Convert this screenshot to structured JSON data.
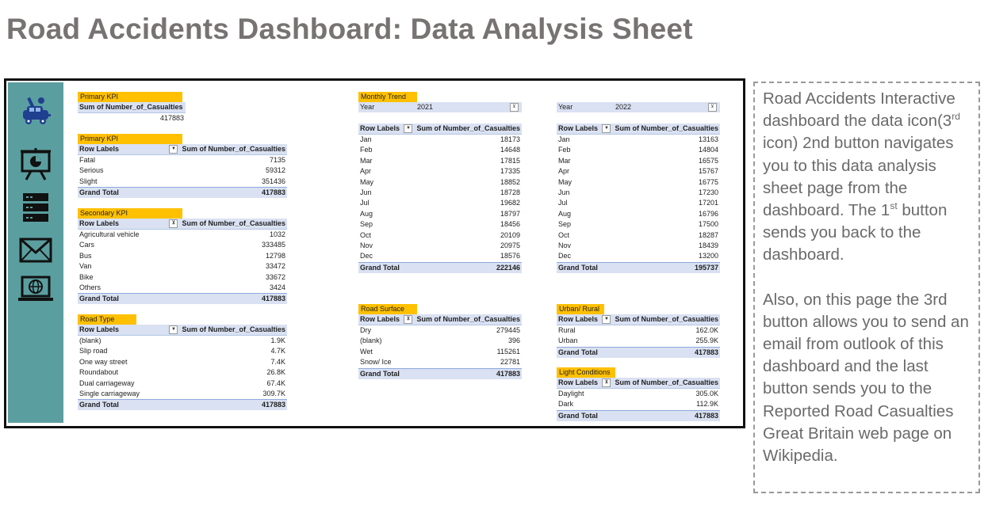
{
  "title": "Road Accidents Dashboard: Data Analysis Sheet",
  "sidebar": {
    "icons": [
      "car-crash-icon",
      "presentation-chart-icon",
      "database-server-icon",
      "mail-envelope-icon",
      "laptop-globe-icon"
    ]
  },
  "kpi_total": {
    "head": "Primary KPI",
    "label": "Sum of Number_of_Casualties",
    "value": "417883"
  },
  "severity": {
    "head": "Primary KPI",
    "col1": "Row Labels",
    "col2": "Sum of Number_of_Casualties",
    "rows": [
      {
        "label": "Fatal",
        "value": "7135"
      },
      {
        "label": "Serious",
        "value": "59312"
      },
      {
        "label": "Slight",
        "value": "351436"
      }
    ],
    "total_label": "Grand Total",
    "total_value": "417883"
  },
  "vehicle": {
    "head": "Secondary KPI",
    "col1": "Row Labels",
    "col2": "Sum of Number_of_Casualties",
    "rows": [
      {
        "label": "Agricultural vehicle",
        "value": "1032"
      },
      {
        "label": "Cars",
        "value": "333485"
      },
      {
        "label": "Bus",
        "value": "12798"
      },
      {
        "label": "Van",
        "value": "33472"
      },
      {
        "label": "Bike",
        "value": "33672"
      },
      {
        "label": "Others",
        "value": "3424"
      }
    ],
    "total_label": "Grand Total",
    "total_value": "417883"
  },
  "road_type": {
    "head": "Road Type",
    "col1": "Row Labels",
    "col2": "Sum of Number_of_Casualties",
    "rows": [
      {
        "label": "(blank)",
        "value": "1.9K"
      },
      {
        "label": "Slip road",
        "value": "4.7K"
      },
      {
        "label": "One way street",
        "value": "7.4K"
      },
      {
        "label": "Roundabout",
        "value": "26.8K"
      },
      {
        "label": "Dual carriageway",
        "value": "67.4K"
      },
      {
        "label": "Single carriageway",
        "value": "309.7K"
      }
    ],
    "total_label": "Grand Total",
    "total_value": "417883"
  },
  "monthly_2021": {
    "head": "Monthly Trend",
    "filter_label": "Year",
    "filter_value": "2021",
    "col1": "Row Labels",
    "col2": "Sum of Number_of_Casualties",
    "rows": [
      {
        "label": "Jan",
        "value": "18173"
      },
      {
        "label": "Feb",
        "value": "14648"
      },
      {
        "label": "Mar",
        "value": "17815"
      },
      {
        "label": "Apr",
        "value": "17335"
      },
      {
        "label": "May",
        "value": "18852"
      },
      {
        "label": "Jun",
        "value": "18728"
      },
      {
        "label": "Jul",
        "value": "19682"
      },
      {
        "label": "Aug",
        "value": "18797"
      },
      {
        "label": "Sep",
        "value": "18456"
      },
      {
        "label": "Oct",
        "value": "20109"
      },
      {
        "label": "Nov",
        "value": "20975"
      },
      {
        "label": "Dec",
        "value": "18576"
      }
    ],
    "total_label": "Grand Total",
    "total_value": "222146"
  },
  "monthly_2022": {
    "filter_label": "Year",
    "filter_value": "2022",
    "col1": "Row Labels",
    "col2": "Sum of Number_of_Casualties",
    "rows": [
      {
        "label": "Jan",
        "value": "13163"
      },
      {
        "label": "Feb",
        "value": "14804"
      },
      {
        "label": "Mar",
        "value": "16575"
      },
      {
        "label": "Apr",
        "value": "15767"
      },
      {
        "label": "May",
        "value": "16775"
      },
      {
        "label": "Jun",
        "value": "17230"
      },
      {
        "label": "Jul",
        "value": "17201"
      },
      {
        "label": "Aug",
        "value": "16796"
      },
      {
        "label": "Sep",
        "value": "17500"
      },
      {
        "label": "Oct",
        "value": "18287"
      },
      {
        "label": "Nov",
        "value": "18439"
      },
      {
        "label": "Dec",
        "value": "13200"
      }
    ],
    "total_label": "Grand Total",
    "total_value": "195737"
  },
  "road_surface": {
    "head": "Road Surface",
    "col1": "Row Labels",
    "col2": "Sum of Number_of_Casualties",
    "rows": [
      {
        "label": "Dry",
        "value": "279445"
      },
      {
        "label": "(blank)",
        "value": "396"
      },
      {
        "label": "Wet",
        "value": "115261"
      },
      {
        "label": "Snow/ Ice",
        "value": "22781"
      }
    ],
    "total_label": "Grand Total",
    "total_value": "417883"
  },
  "urban_rural": {
    "head": "Urban/ Rural",
    "col1": "Row Labels",
    "col2": "Sum of Number_of_Casualties",
    "rows": [
      {
        "label": "Rural",
        "value": "162.0K"
      },
      {
        "label": "Urban",
        "value": "255.9K"
      }
    ],
    "total_label": "Grand Total",
    "total_value": "417883"
  },
  "light": {
    "head": "Light Conditions",
    "col1": "Row Labels",
    "col2": "Sum of Number_of_Casualties",
    "rows": [
      {
        "label": "Daylight",
        "value": "305.0K"
      },
      {
        "label": "Dark",
        "value": "112.9K"
      }
    ],
    "total_label": "Grand Total",
    "total_value": "417883"
  },
  "note": {
    "p1_a": "Road Accidents Interactive dashboard the data icon(3",
    "p1_sup1": "rd",
    "p1_b": " icon) 2nd button navigates you to this data analysis sheet page from the dashboard. The 1",
    "p1_sup2": "st",
    "p1_c": " button sends you back to the dashboard.",
    "p2": "Also, on this page the 3rd button allows you to send an email from outlook of this dashboard and the last button sends you to the Reported Road Casualties Great Britain web page on Wikipedia."
  },
  "colors": {
    "sidebar": "#5b9ea0",
    "icon": "#1f3f8f",
    "header_fill": "#d9e1f2",
    "section_tag": "#ffc000",
    "title_text": "#777372"
  }
}
